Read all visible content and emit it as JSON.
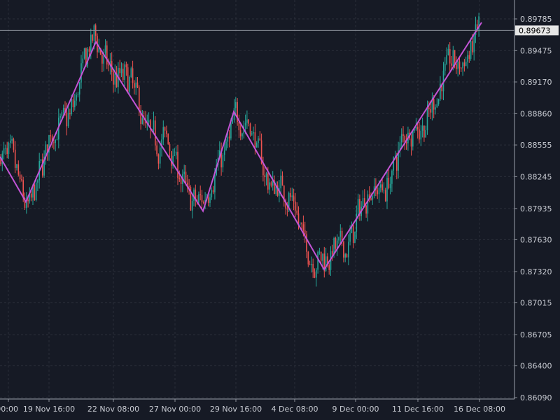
{
  "chart_data": {
    "type": "candlestick",
    "price_axis": {
      "ticks": [
        "0.89785",
        "0.89475",
        "0.89170",
        "0.88860",
        "0.88555",
        "0.88245",
        "0.87935",
        "0.87630",
        "0.87320",
        "0.87015",
        "0.86705",
        "0.86400",
        "0.86090"
      ],
      "range": [
        0.8609,
        0.89785
      ]
    },
    "time_axis": {
      "ticks": [
        "00:00",
        "19 Nov 16:00",
        "22 Nov 08:00",
        "27 Nov 00:00",
        "29 Nov 16:00",
        "4 Dec 08:00",
        "9 Dec 00:00",
        "11 Dec 16:00",
        "16 Dec 08:00"
      ]
    },
    "current_price": "0.89673",
    "zigzag": {
      "color": "#c354d6",
      "points": [
        {
          "label": "19 Nov 00:00",
          "price": 0.8844
        },
        {
          "label": "19 Nov 16:00",
          "price": 0.88
        },
        {
          "label": "22 Nov 08:00",
          "price": 0.8956
        },
        {
          "label": "27 Nov 00:00",
          "price": 0.8791
        },
        {
          "label": "29 Nov 16:00",
          "price": 0.8888
        },
        {
          "label": "9 Dec 00:00",
          "price": 0.8734
        },
        {
          "label": "16 Dec 08:00",
          "price": 0.8975
        }
      ]
    },
    "series": [
      {
        "name": "up",
        "color": "#26a69a"
      },
      {
        "name": "down",
        "color": "#ef5350"
      }
    ],
    "grid": true,
    "colors": {
      "background": "#161a25",
      "grid": "#2a2e39",
      "axis_text": "#c9ccd3",
      "current_price_line": "#8a8f98",
      "current_price_label_bg": "#e6e6e6",
      "current_price_label_text": "#000000"
    }
  }
}
